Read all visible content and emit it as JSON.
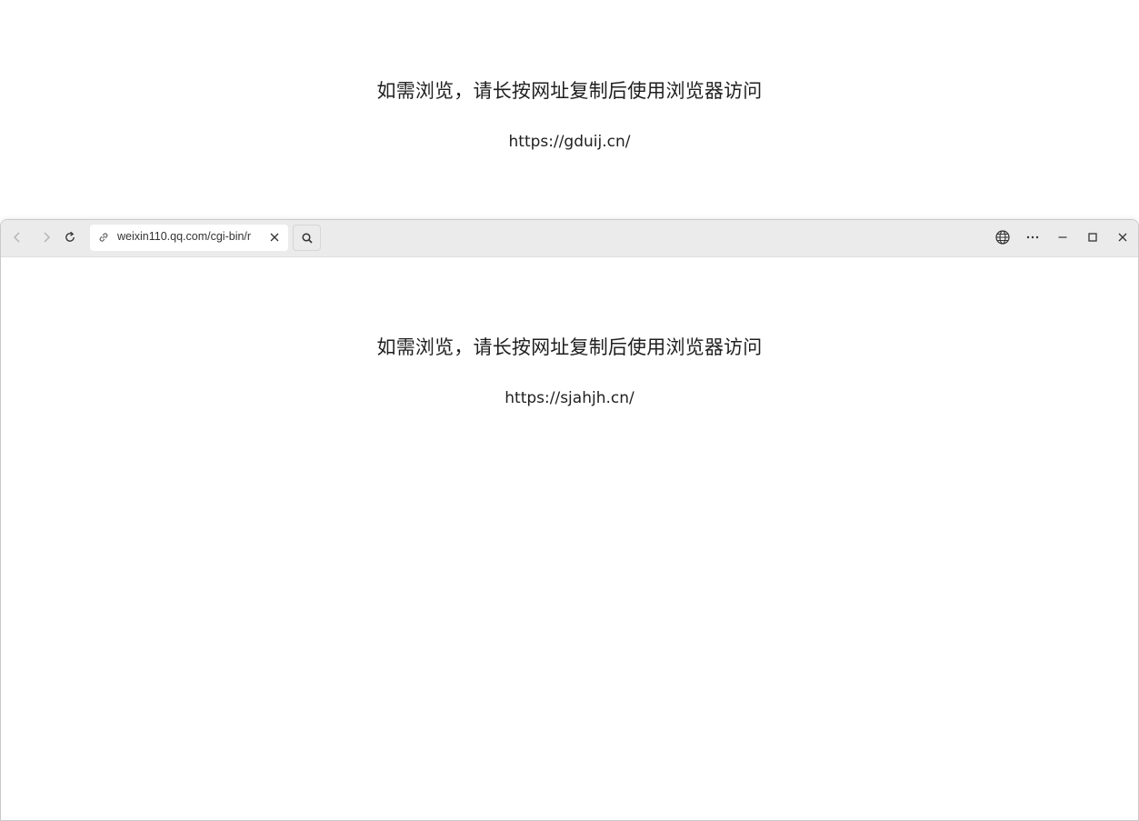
{
  "background_page": {
    "message": "如需浏览，请长按网址复制后使用浏览器访问",
    "url": "https://gduij.cn/"
  },
  "browser": {
    "address_bar": {
      "value": "weixin110.qq.com/cgi-bin/r"
    },
    "toolbar_icons": {
      "back": "back-arrow-icon",
      "forward": "forward-arrow-icon",
      "reload": "reload-icon",
      "link": "link-icon",
      "clear": "close-icon",
      "search": "search-icon",
      "globe": "globe-icon",
      "more": "more-icon",
      "minimize": "minimize-icon",
      "maximize": "maximize-icon",
      "close": "close-icon"
    },
    "content": {
      "message": "如需浏览，请长按网址复制后使用浏览器访问",
      "url": "https://sjahjh.cn/"
    }
  },
  "colors": {
    "toolbar_bg": "#ebebeb",
    "page_bg": "#ffffff",
    "text": "#1f1f1f"
  }
}
